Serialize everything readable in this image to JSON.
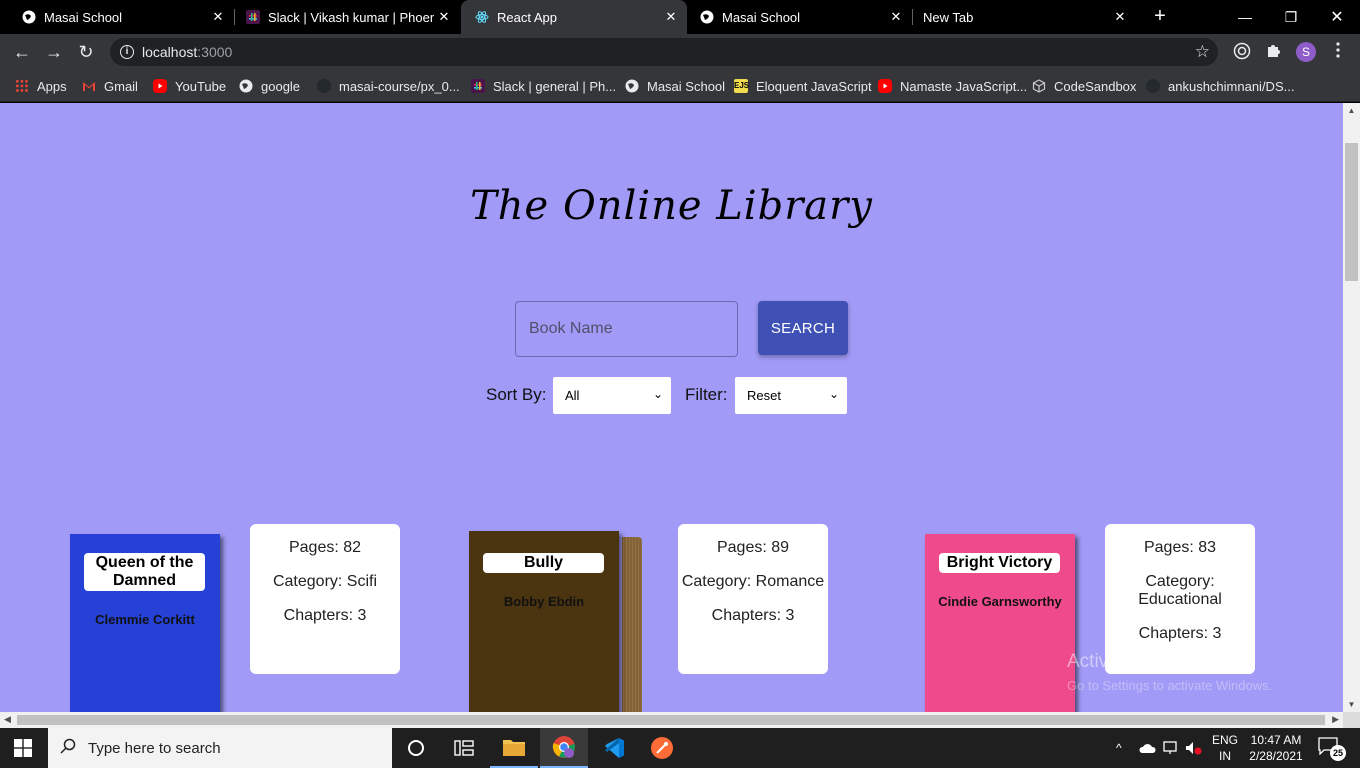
{
  "browser": {
    "tabs": [
      {
        "title": "Masai School",
        "active": false
      },
      {
        "title": "Slack | Vikash kumar | Phoenix",
        "active": false
      },
      {
        "title": "React App",
        "active": true
      },
      {
        "title": "Masai School",
        "active": false
      },
      {
        "title": "New Tab",
        "active": false
      }
    ],
    "close_glyph": "✕",
    "new_tab_glyph": "+",
    "window_controls": {
      "minimize": "—",
      "maximize": "❐",
      "close": "✕"
    },
    "nav": {
      "back": "←",
      "forward": "→",
      "reload": "↻"
    },
    "address": {
      "host": "localhost",
      "port": ":3000",
      "info_glyph": "i",
      "star_glyph": "☆"
    },
    "profile_initial": "S",
    "bookmarks": [
      {
        "label": "Apps",
        "icon": "apps-grid-icon",
        "color": "#e94335"
      },
      {
        "label": "Gmail",
        "icon": "gmail-icon",
        "color": "#ea4335"
      },
      {
        "label": "YouTube",
        "icon": "youtube-icon",
        "color": "#ff0000"
      },
      {
        "label": "google",
        "icon": "globe-icon",
        "color": "#e8eaed"
      },
      {
        "label": "masai-course/px_0...",
        "icon": "github-icon",
        "color": "#24292e"
      },
      {
        "label": "Slack | general | Ph...",
        "icon": "slack-icon",
        "color": "#4a154b"
      },
      {
        "label": "Masai School",
        "icon": "globe-icon",
        "color": "#e8eaed"
      },
      {
        "label": "Eloquent JavaScript",
        "icon": "ejs-icon",
        "color": "#f0db4f"
      },
      {
        "label": "Namaste JavaScript...",
        "icon": "youtube-icon",
        "color": "#ff0000"
      },
      {
        "label": "CodeSandbox",
        "icon": "codesandbox-icon",
        "color": "#cccccc"
      },
      {
        "label": "ankushchimnani/DS...",
        "icon": "github-icon",
        "color": "#24292e"
      }
    ]
  },
  "app": {
    "heading": "The Online Library",
    "search": {
      "placeholder": "Book Name",
      "button_label": "SEARCH"
    },
    "sort": {
      "label": "Sort By:",
      "selected": "All"
    },
    "filter": {
      "label": "Filter:",
      "selected": "Reset"
    },
    "books": [
      {
        "title": "Queen of the Damned",
        "author": "Clemmie Corkitt",
        "color": "#2541d6",
        "pages_label": "Pages: 82",
        "category_label": "Category: Scifi",
        "chapters_label": "Chapters: 3"
      },
      {
        "title": "Bully",
        "author": "Bobby Ebdin",
        "color": "#4a3510",
        "pages_label": "Pages: 89",
        "category_label": "Category: Romance",
        "chapters_label": "Chapters: 3"
      },
      {
        "title": "Bright Victory",
        "author": "Cindie Garnsworthy",
        "color": "#ef4b8c",
        "pages_label": "Pages: 83",
        "category_label": "Category: Educational",
        "chapters_label": "Chapters: 3"
      }
    ]
  },
  "watermark": {
    "line1": "Activate Windows",
    "line2": "Go to Settings to activate Windows."
  },
  "taskbar": {
    "search_placeholder": "Type here to search",
    "language": [
      "ENG",
      "IN"
    ],
    "time": "10:47 AM",
    "date": "2/28/2021",
    "notification_count": "25"
  }
}
